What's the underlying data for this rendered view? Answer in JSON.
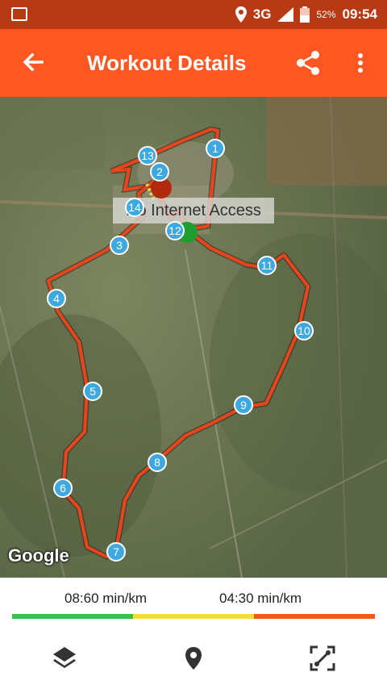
{
  "status_bar": {
    "network": "3G",
    "battery": "52%",
    "time": "09:54"
  },
  "app_bar": {
    "title": "Workout Details",
    "back_icon": "arrow-back-icon",
    "share_icon": "share-icon",
    "more_icon": "more-vert-icon"
  },
  "map": {
    "banner": "No Internet Access",
    "attribution": "Google",
    "markers": [
      "1",
      "2",
      "3",
      "4",
      "5",
      "6",
      "7",
      "8",
      "9",
      "10",
      "11",
      "12",
      "13",
      "14"
    ],
    "colors": {
      "route": "#e8451c",
      "marker": "#3ea8e0",
      "start": "#1f9d2e",
      "end": "#b22a0e"
    }
  },
  "pace_legend": {
    "slow": "08:60 min/km",
    "fast": "04:30 min/km",
    "colors": [
      "#3bc14a",
      "#f7dc3a",
      "#f05a22"
    ]
  },
  "bottom_bar": {
    "layers_icon": "layers-icon",
    "location_icon": "location-pin-icon",
    "fit_icon": "fit-route-icon"
  }
}
